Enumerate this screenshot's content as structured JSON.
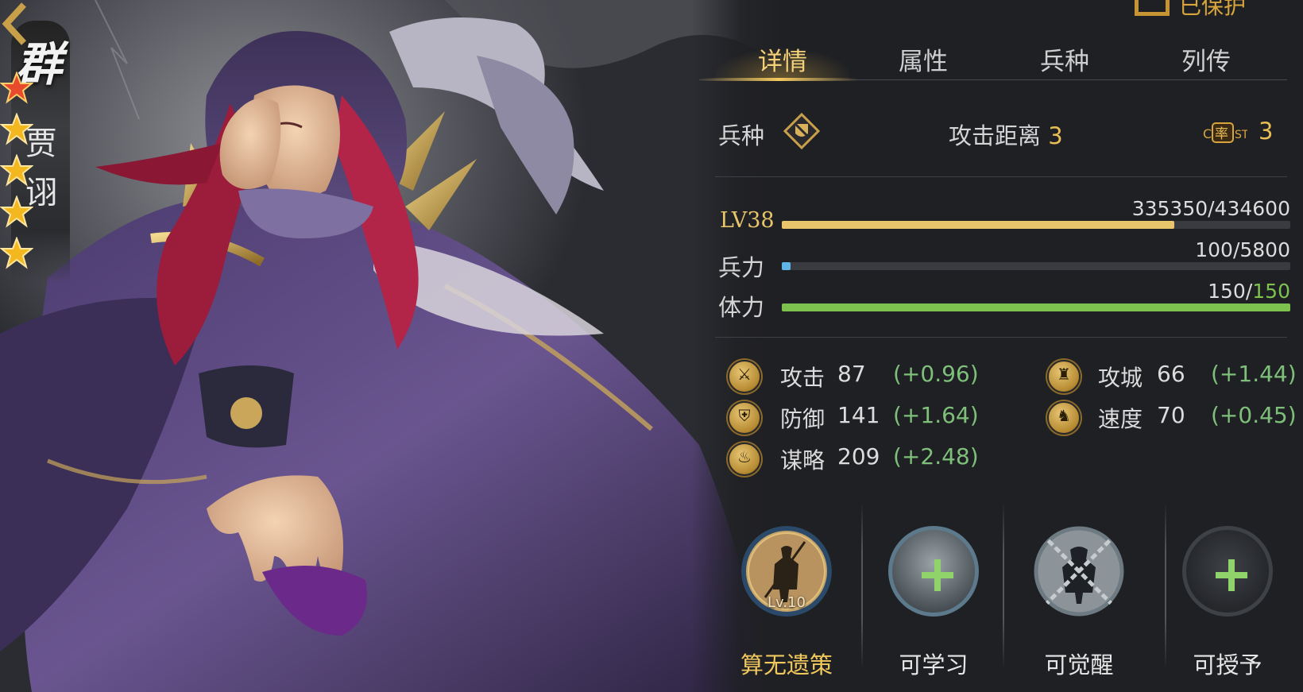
{
  "header": {
    "protect_label": "已保护"
  },
  "hero": {
    "faction": "群",
    "name_chars": [
      "贾",
      "诩"
    ],
    "stars": 5
  },
  "tabs": [
    {
      "label": "详情",
      "active": true
    },
    {
      "label": "属性",
      "active": false
    },
    {
      "label": "兵种",
      "active": false
    },
    {
      "label": "列传",
      "active": false
    }
  ],
  "troop": {
    "type_label": "兵种",
    "type_icon": "shield-banner-icon",
    "range_label": "攻击距离",
    "range_value": "3",
    "command_icon": "command-rate-icon",
    "command_value": "3"
  },
  "bars": {
    "level": {
      "label": "LV38",
      "value": "335350/434600",
      "fraction": 0.7716,
      "color": "#e8c56a"
    },
    "troops": {
      "label": "兵力",
      "value": "100/5800",
      "fraction": 0.0172,
      "color": "#5fb6e6"
    },
    "stamina": {
      "label": "体力",
      "value_current": "150",
      "value_sep": "/",
      "value_max": "150",
      "fraction": 1.0,
      "color": "#7dc24e"
    }
  },
  "stats": [
    {
      "name": "攻击",
      "value": "87",
      "bonus": "(+0.96)",
      "icon": "sword-icon"
    },
    {
      "name": "攻城",
      "value": "66",
      "bonus": "(+1.44)",
      "icon": "castle-icon"
    },
    {
      "name": "防御",
      "value": "141",
      "bonus": "(+1.64)",
      "icon": "shield-icon"
    },
    {
      "name": "速度",
      "value": "70",
      "bonus": "(+0.45)",
      "icon": "horse-icon"
    },
    {
      "name": "谋略",
      "value": "209",
      "bonus": "(+2.48)",
      "icon": "flame-icon"
    }
  ],
  "skills": [
    {
      "label": "算无遗策",
      "level": "Lv.10",
      "icon": "strategist-silhouette-icon"
    },
    {
      "label": "可学习",
      "icon": "learn-plus-icon"
    },
    {
      "label": "可觉醒",
      "icon": "awaken-chained-icon"
    },
    {
      "label": "可授予",
      "icon": "grant-plus-icon"
    }
  ]
}
